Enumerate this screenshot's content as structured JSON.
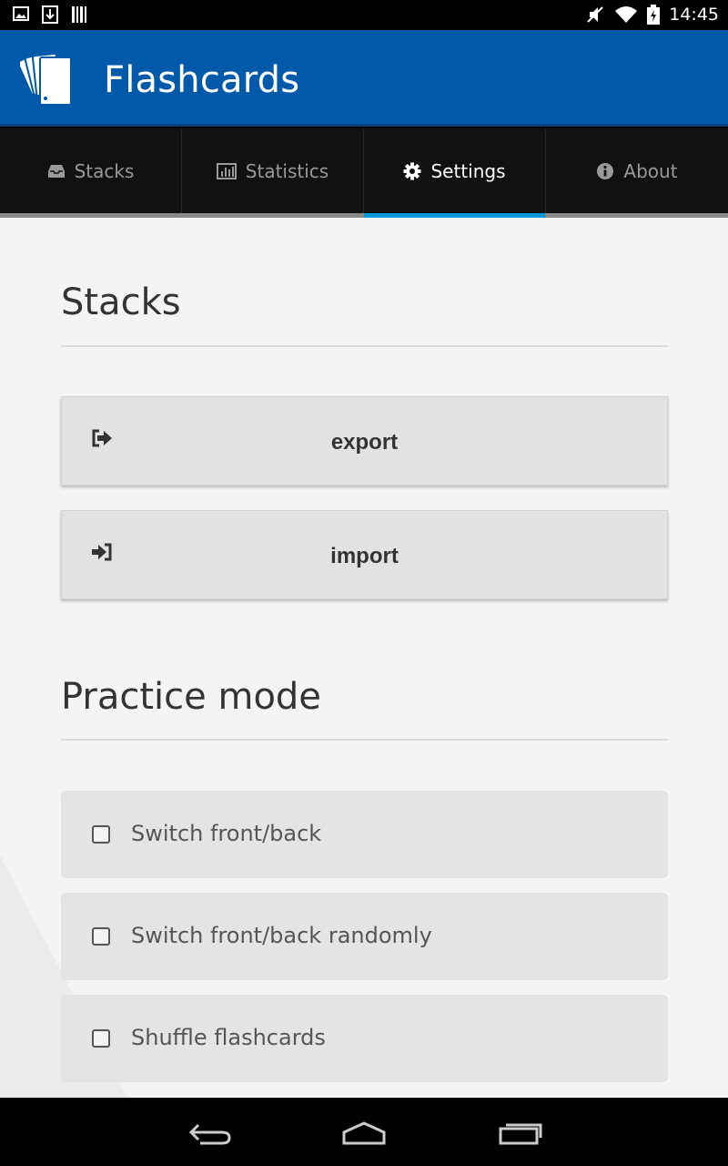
{
  "status_bar": {
    "time": "14:45"
  },
  "app": {
    "title": "Flashcards",
    "logo_icon": "flashcards-logo-icon",
    "bar_color": "#0059a9"
  },
  "tabs": [
    {
      "label": "Stacks",
      "icon": "inbox-icon",
      "active": false
    },
    {
      "label": "Statistics",
      "icon": "bar-chart-icon",
      "active": false
    },
    {
      "label": "Settings",
      "icon": "gear-icon",
      "active": true
    },
    {
      "label": "About",
      "icon": "info-icon",
      "active": false
    }
  ],
  "accent_color": "#0098d8",
  "stacks_section": {
    "title": "Stacks",
    "export_label": "export",
    "import_label": "import"
  },
  "practice_section": {
    "title": "Practice mode",
    "options": [
      {
        "label": "Switch front/back",
        "checked": false
      },
      {
        "label": "Switch front/back randomly",
        "checked": false
      },
      {
        "label": "Shuffle flashcards",
        "checked": false
      }
    ]
  }
}
